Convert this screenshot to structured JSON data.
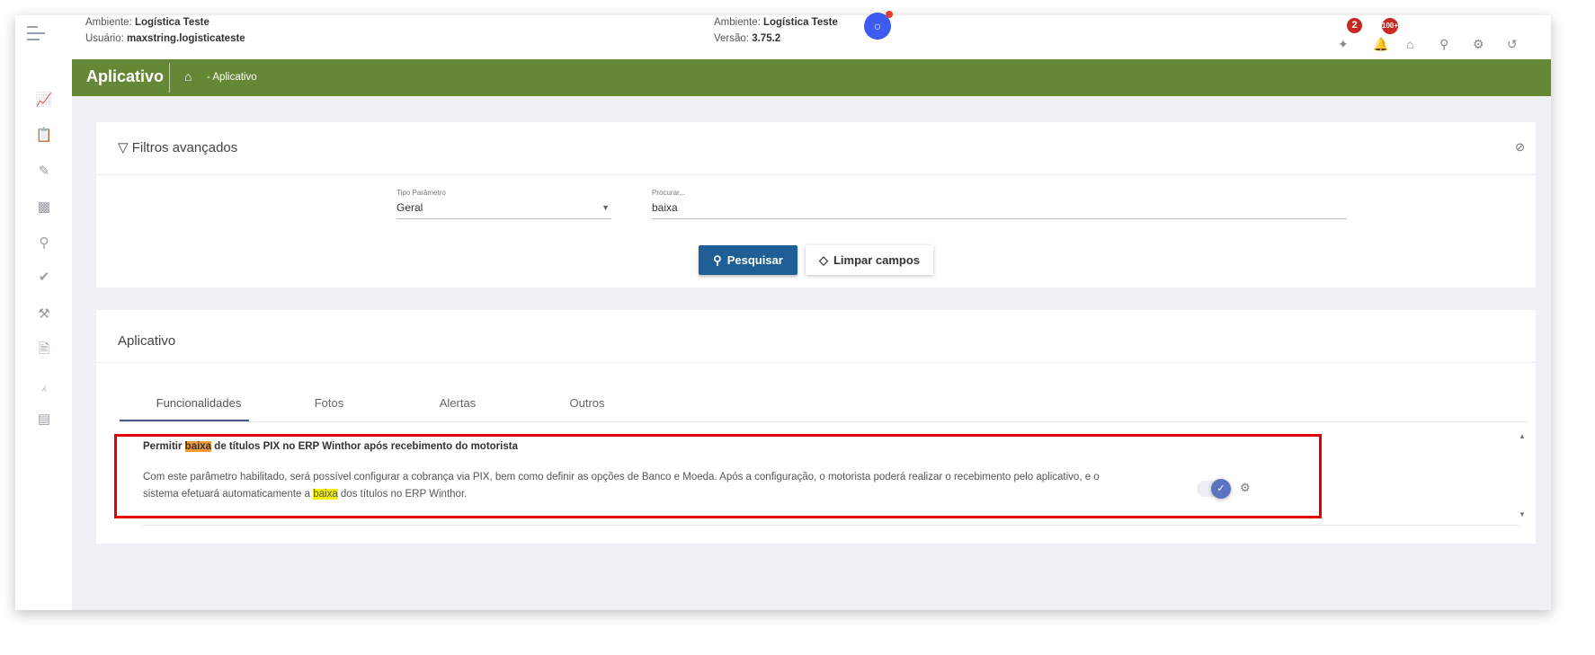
{
  "header": {
    "env_label": "Ambiente:",
    "env_value": "Logística Teste",
    "user_label": "Usuário:",
    "user_value": "maxstring.logisticateste",
    "env2_label": "Ambiente:",
    "env2_value": "Logística Teste",
    "version_label": "Versão:",
    "version_value": "3.75.2",
    "badge_alerts": "2",
    "badge_notifications": "100+"
  },
  "breadcrumb": {
    "title": "Aplicativo",
    "path": "- Aplicativo"
  },
  "filters": {
    "title": "Filtros avançados",
    "type_label": "Tipo Parâmetro",
    "type_value": "Geral",
    "search_label": "Procurar...",
    "search_value": "baixa",
    "search_button": "Pesquisar",
    "clear_button": "Limpar campos"
  },
  "app_card": {
    "title": "Aplicativo",
    "tabs": [
      "Funcionalidades",
      "Fotos",
      "Alertas",
      "Outros"
    ],
    "active_tab": "Funcionalidades"
  },
  "item": {
    "title_pre": "Permitir ",
    "title_hl": "baixa",
    "title_post": " de títulos PIX no ERP Winthor após recebimento do motorista",
    "desc_line1": "Com este parâmetro habilitado, será possível configurar a cobrança via PIX, bem como definir as opções de Banco e Moeda. Após a configuração, o motorista poderá realizar o recebimento pelo aplicativo, e o",
    "desc_pre": "sistema efetuará automaticamente a ",
    "desc_hl": "baixa",
    "desc_post": " dos títulos no ERP Winthor.",
    "enabled": true
  },
  "colors": {
    "brand": "#648835",
    "primary": "#1f5f95",
    "highlight": "#e00000"
  }
}
